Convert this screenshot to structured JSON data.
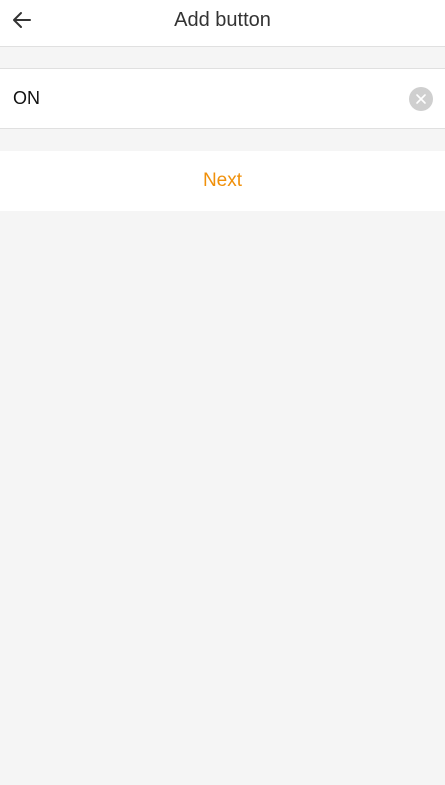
{
  "header": {
    "title": "Add button",
    "back_icon": "arrow-left-icon"
  },
  "form": {
    "name_value": "ON",
    "clear_icon": "clear-circle-icon"
  },
  "actions": {
    "next_label": "Next"
  },
  "colors": {
    "accent": "#f0900a",
    "background": "#f5f5f5",
    "surface": "#ffffff"
  }
}
